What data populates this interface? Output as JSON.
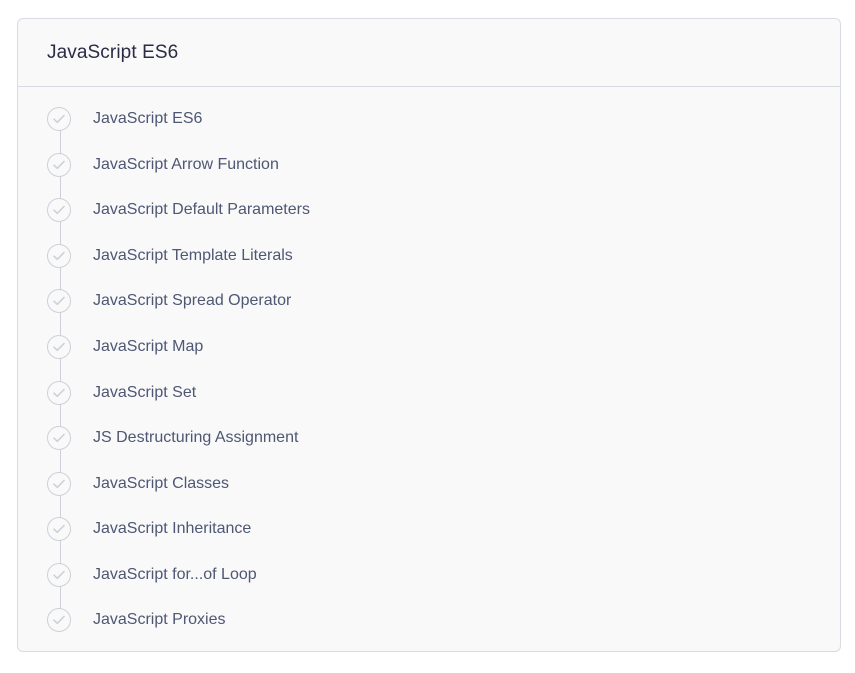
{
  "section": {
    "title": "JavaScript ES6"
  },
  "topics": [
    {
      "label": "JavaScript ES6"
    },
    {
      "label": "JavaScript Arrow Function"
    },
    {
      "label": "JavaScript Default Parameters"
    },
    {
      "label": "JavaScript Template Literals"
    },
    {
      "label": "JavaScript Spread Operator"
    },
    {
      "label": "JavaScript Map"
    },
    {
      "label": "JavaScript Set"
    },
    {
      "label": "JS Destructuring Assignment"
    },
    {
      "label": "JavaScript Classes"
    },
    {
      "label": "JavaScript Inheritance"
    },
    {
      "label": "JavaScript for...of Loop"
    },
    {
      "label": "JavaScript Proxies"
    }
  ],
  "icons": {
    "status": "check-circle-icon"
  },
  "colors": {
    "text": "#4e5773",
    "title": "#2b2b45",
    "border": "#d9dbe2",
    "check": "#cdd0d8",
    "background": "#f9f9fa"
  }
}
